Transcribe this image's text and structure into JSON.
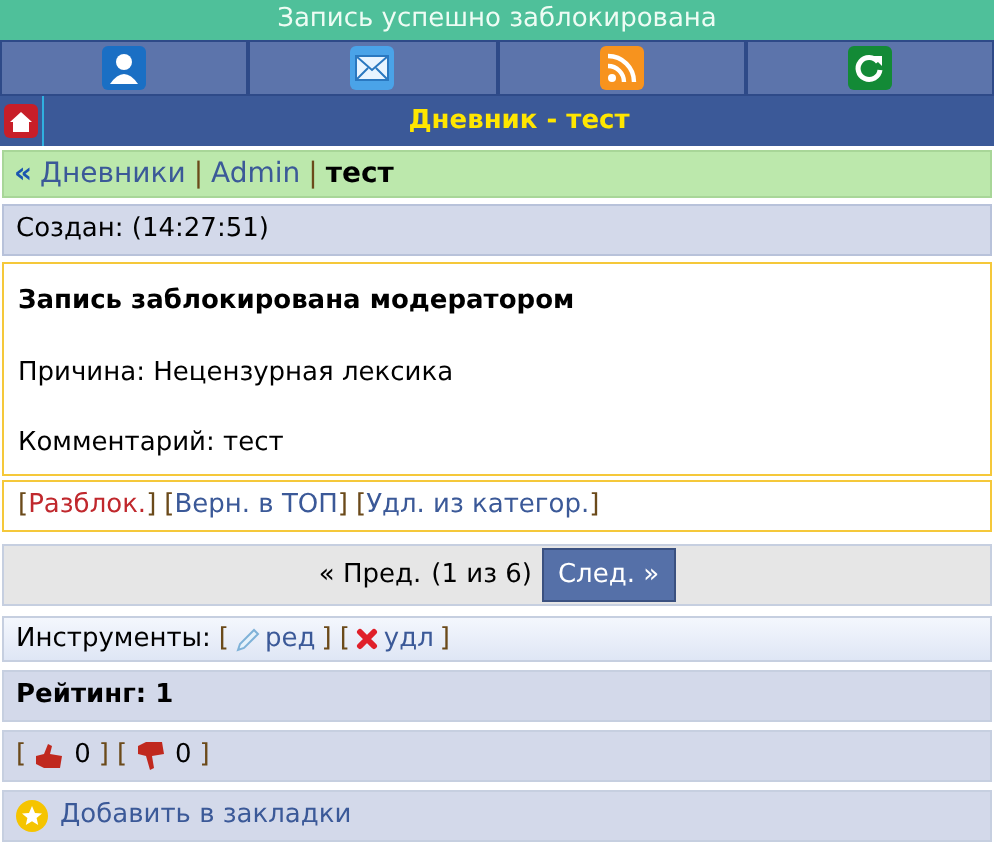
{
  "status_message": "Запись успешно заблокирована",
  "nav_icons": [
    {
      "kind": "user"
    },
    {
      "kind": "mail"
    },
    {
      "kind": "rss"
    },
    {
      "kind": "refresh"
    }
  ],
  "title": "Дневник - тест",
  "breadcrumb": {
    "back": "«",
    "links": [
      {
        "label": "Дневники",
        "separator": "|"
      },
      {
        "label": "Admin",
        "separator": "|"
      }
    ],
    "current": "тест"
  },
  "created": "Создан: (14:27:51)",
  "notice": {
    "heading": "Запись заблокирована модератором",
    "reason": "Причина: Нецензурная лексика",
    "comment": "Комментарий: тест"
  },
  "actions": [
    {
      "open": "[",
      "label": "Разблок.",
      "close": "]",
      "kind": "danger"
    },
    {
      "open": "[",
      "label": "Верн. в ТОП",
      "close": "]",
      "kind": "normal"
    },
    {
      "open": "[",
      "label": "Удл. из категор.",
      "close": "]",
      "kind": "normal"
    }
  ],
  "pager": {
    "prev": "« Пред.",
    "info": "(1 из 6)",
    "next": "След. »"
  },
  "tools": {
    "label": "Инструменты:",
    "items": [
      {
        "kind": "edit",
        "open": "[",
        "label": "ред",
        "close": "]"
      },
      {
        "kind": "delete",
        "open": "[",
        "label": "удл",
        "close": "]"
      }
    ]
  },
  "rating": "Рейтинг: 1",
  "votes": [
    {
      "kind": "up",
      "open": "[",
      "count": "0",
      "close": "]"
    },
    {
      "kind": "down",
      "open": "[",
      "count": "0",
      "close": "]"
    }
  ],
  "bookmark": "Добавить в закладки"
}
